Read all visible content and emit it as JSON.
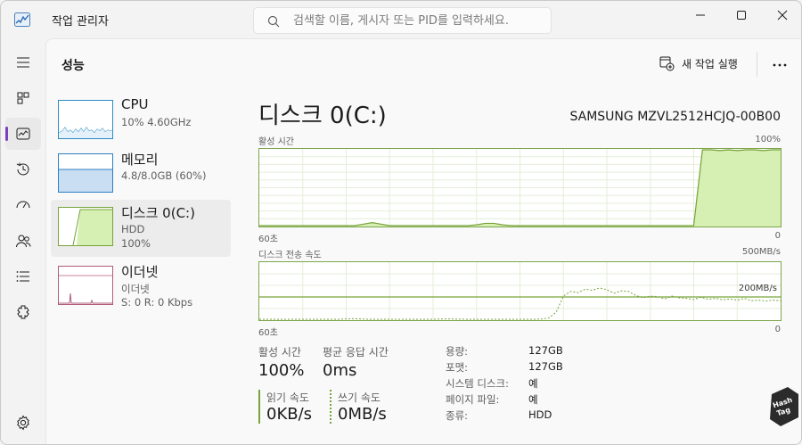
{
  "app": {
    "title": "작업 관리자",
    "search_placeholder": "검색할 이름, 게시자 또는 PID를 입력하세요."
  },
  "nav": {
    "items": [
      {
        "name": "menu-icon",
        "active": false
      },
      {
        "name": "processes-icon",
        "active": false
      },
      {
        "name": "performance-icon",
        "active": true
      },
      {
        "name": "app-history-icon",
        "active": false
      },
      {
        "name": "startup-apps-icon",
        "active": false
      },
      {
        "name": "users-icon",
        "active": false
      },
      {
        "name": "details-icon",
        "active": false
      },
      {
        "name": "services-icon",
        "active": false
      }
    ],
    "settings": "settings-icon"
  },
  "header": {
    "page_title": "성능",
    "new_task_label": "새 작업 실행",
    "more_label": "···"
  },
  "devices": [
    {
      "name": "CPU",
      "line1": "10% 4.60GHz",
      "line2": "",
      "line3": ""
    },
    {
      "name": "메모리",
      "line1": "4.8/8.0GB (60%)",
      "line2": "",
      "line3": ""
    },
    {
      "name": "디스크 0(C:)",
      "line1": "HDD",
      "line2": "100%",
      "line3": ""
    },
    {
      "name": "이더넷",
      "line1": "이더넷",
      "line2": "S: 0 R: 0 Kbps",
      "line3": ""
    }
  ],
  "disk": {
    "title": "디스크 0(C:)",
    "model": "SAMSUNG MZVL2512HCJQ-00B00",
    "active_time_label": "활성 시간",
    "active_time_max": "100%",
    "active_time_left": "60초",
    "active_time_right": "0",
    "active_time_series": [
      0,
      0,
      0,
      0,
      0,
      0,
      0,
      0,
      0,
      0,
      0,
      0,
      2,
      4,
      2,
      0,
      0,
      0,
      0,
      0,
      0,
      0,
      0,
      0,
      0,
      1,
      3,
      3,
      1,
      0,
      0,
      0,
      0,
      0,
      0,
      0,
      0,
      0,
      0,
      0,
      0,
      0,
      0,
      0,
      0,
      0,
      0,
      0,
      0,
      0,
      0,
      100,
      100,
      99,
      100,
      99,
      100,
      100,
      99,
      100,
      100
    ],
    "transfer_label": "디스크 전송 속도",
    "transfer_max": "500MB/s",
    "transfer_left": "60초",
    "transfer_right": "0",
    "transfer_ref_label": "200MB/s",
    "transfer_ref_value": 200,
    "transfer_max_value": 500,
    "transfer_series": [
      0,
      0,
      0,
      0,
      0,
      0,
      0,
      0,
      0,
      0,
      0,
      0,
      3,
      5,
      3,
      0,
      0,
      0,
      0,
      0,
      0,
      0,
      0,
      0,
      0,
      2,
      3,
      2,
      1,
      0,
      0,
      0,
      0,
      0,
      0,
      0,
      0,
      0,
      0,
      2,
      12,
      60,
      200,
      240,
      230,
      260,
      250,
      270,
      255,
      225,
      245,
      240,
      205,
      185,
      200,
      195,
      175,
      200,
      185,
      180,
      170,
      190,
      172,
      180,
      168,
      175,
      165,
      180,
      160,
      165,
      158,
      165,
      160
    ],
    "stats": {
      "active_label": "활성 시간",
      "active_value": "100%",
      "avg_label": "평균 응답 시간",
      "avg_value": "0ms",
      "read_label": "읽기 속도",
      "read_value": "0KB/s",
      "write_label": "쓰기 속도",
      "write_value": "0MB/s"
    },
    "properties": [
      {
        "key": "용량:",
        "value": "127GB"
      },
      {
        "key": "포맷:",
        "value": "127GB"
      },
      {
        "key": "시스템 디스크:",
        "value": "예"
      },
      {
        "key": "페이지 파일:",
        "value": "예"
      },
      {
        "key": "종류:",
        "value": "HDD"
      }
    ]
  },
  "colors": {
    "disk_accent": "#77a33a",
    "disk_fill": "#d6efb3",
    "cpu": "#2c8cc4",
    "memory": "#8e5fb2",
    "ethernet": "#b15b7c",
    "nav_accent": "#7b3fbf"
  },
  "watermark": "Hash Tag"
}
